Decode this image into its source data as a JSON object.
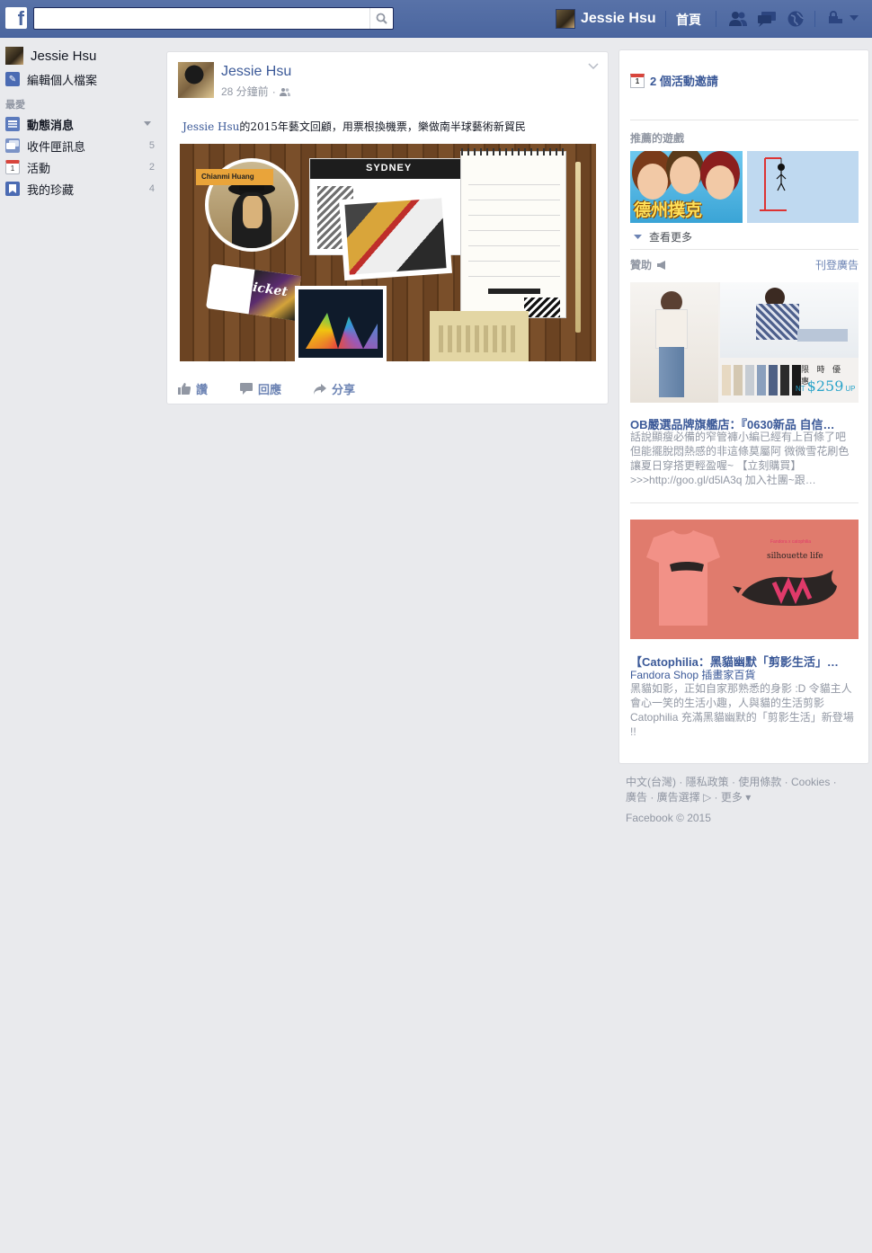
{
  "topbar": {
    "logo": "f",
    "search_placeholder": "",
    "user_name": "Jessie  Hsu",
    "home_label": "首頁",
    "icons": [
      "friend-requests-icon",
      "messages-icon",
      "notifications-icon",
      "privacy-icon",
      "settings-icon"
    ],
    "brand_color": "#4b669f"
  },
  "left": {
    "user_name": "Jessie  Hsu",
    "edit_profile": "編輯個人檔案",
    "section_favorites": "最愛",
    "items": [
      {
        "label": "動態消息",
        "count": "",
        "icon": "news-feed-icon"
      },
      {
        "label": "收件匣訊息",
        "count": "5",
        "icon": "inbox-icon"
      },
      {
        "label": "活動",
        "count": "2",
        "icon": "events-icon"
      },
      {
        "label": "我的珍藏",
        "count": "4",
        "icon": "saved-icon"
      }
    ]
  },
  "post": {
    "author": "Jessie Hsu",
    "time": "28 分鐘前",
    "tag": "Jessie Hsu",
    "text": "的2015年藝文回顧，用票根換機票，樂做南半球藝術新貿民",
    "image": {
      "label_name": "Chianmi Huang",
      "sydney": "SYDNEY",
      "ticket": "ticket"
    },
    "actions": {
      "like": "讚",
      "comment": "回應",
      "share": "分享"
    }
  },
  "right": {
    "events": "2 個活動邀請",
    "calendar_day": "1",
    "games_head": "推薦的遊戲",
    "game1_title": "德州撲克",
    "see_more": "查看更多",
    "sponsored": "贊助",
    "create_ad": "刊登廣告",
    "ad1": {
      "price_label": "限 時 優 惠",
      "price_prefix": "NT",
      "price": "$259",
      "price_suffix": "UP",
      "title": "OB嚴選品牌旗艦店：『0630新品 自信…",
      "body": "話說顯瘦必備的窄管褲小編已經有上百條了吧 但能擺脫悶熱感的非這條莫屬阿 微微雪花刷色讓夏日穿搭更輕盈喔~ 【立刻購買】>>>http://goo.gl/d5lA3q 加入社團~跟…"
    },
    "ad2": {
      "brand_small": "Fandora x catophilia",
      "tagline": "silhouette life",
      "title": "【Catophilia：黑貓幽默「剪影生活」…",
      "subtitle": "Fandora Shop 插畫家百貨",
      "body": "黑貓如影，正如自家那熟悉的身影 :D 令貓主人會心一笑的生活小趣，人與貓的生活剪影 Catophilia 充滿黑貓幽默的「剪影生活」新登場 !!"
    }
  },
  "footer": {
    "line1": "中文(台灣) · 隱私政策 · 使用條款 · Cookies ·",
    "line2": "廣告 · 廣告選擇 ▷ · 更多 ▾",
    "copyright": "Facebook © 2015"
  }
}
